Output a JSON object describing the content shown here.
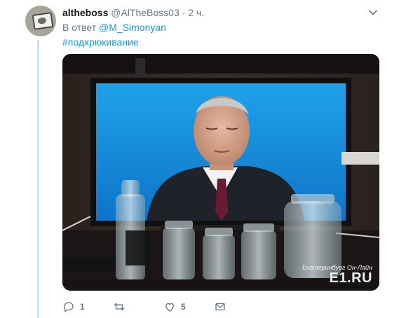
{
  "tweet": {
    "author_name": "altheboss",
    "author_handle": "@AlTheBoss03",
    "separator": "·",
    "time": "2 ч.",
    "reply_prefix": "В ответ",
    "reply_mention": "@M_Simonyan",
    "hashtag": "#подхрюкивание"
  },
  "media": {
    "watermark_small": "Екатеринбург Он-Лайн",
    "watermark_logo": "E1.RU"
  },
  "actions": {
    "reply_count": "1",
    "retweet_count": "",
    "like_count": "5"
  },
  "colors": {
    "link": "#1b95e0",
    "muted": "#657786",
    "thread_line": "#c4e3f7"
  },
  "icons": [
    "avatar",
    "chevron-down-icon",
    "reply-icon",
    "retweet-icon",
    "like-icon",
    "message-icon"
  ]
}
